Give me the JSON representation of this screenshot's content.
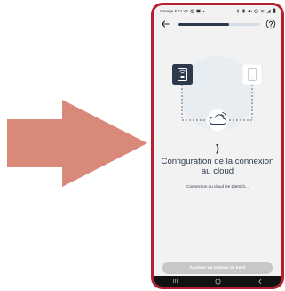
{
  "colors": {
    "arrow": "#d9897a",
    "phone_frame": "#b32130",
    "accent_dark": "#2c3a4b",
    "progress_track": "#d6dde5",
    "button_disabled": "#c5c7c9"
  },
  "status_bar": {
    "carrier_time": "Orange F 11:42",
    "icons": [
      "alarm-icon",
      "image-icon",
      "dot-icon",
      "bluetooth-icon",
      "vibrate-icon",
      "mute-icon",
      "alarm-icon",
      "wifi-icon",
      "signal-icon",
      "battery-icon"
    ]
  },
  "top_bar": {
    "back_icon": "arrow-left-icon",
    "progress": 0.62,
    "help_icon": "help-circle-icon"
  },
  "illustration": {
    "device_icon": "boiler-control-icon",
    "phone_icon": "smartphone-icon",
    "cloud_icon": "cloud-sync-icon"
  },
  "spinner_glyph": ")",
  "main": {
    "title": "Configuration de la connexion au cloud",
    "subtitle": "Connection au cloud De Dietrich..."
  },
  "cta": {
    "label": "Accéder au tableau de bord"
  },
  "nav_bar": {
    "icons": [
      "recent-apps-icon",
      "home-icon",
      "back-icon"
    ]
  }
}
